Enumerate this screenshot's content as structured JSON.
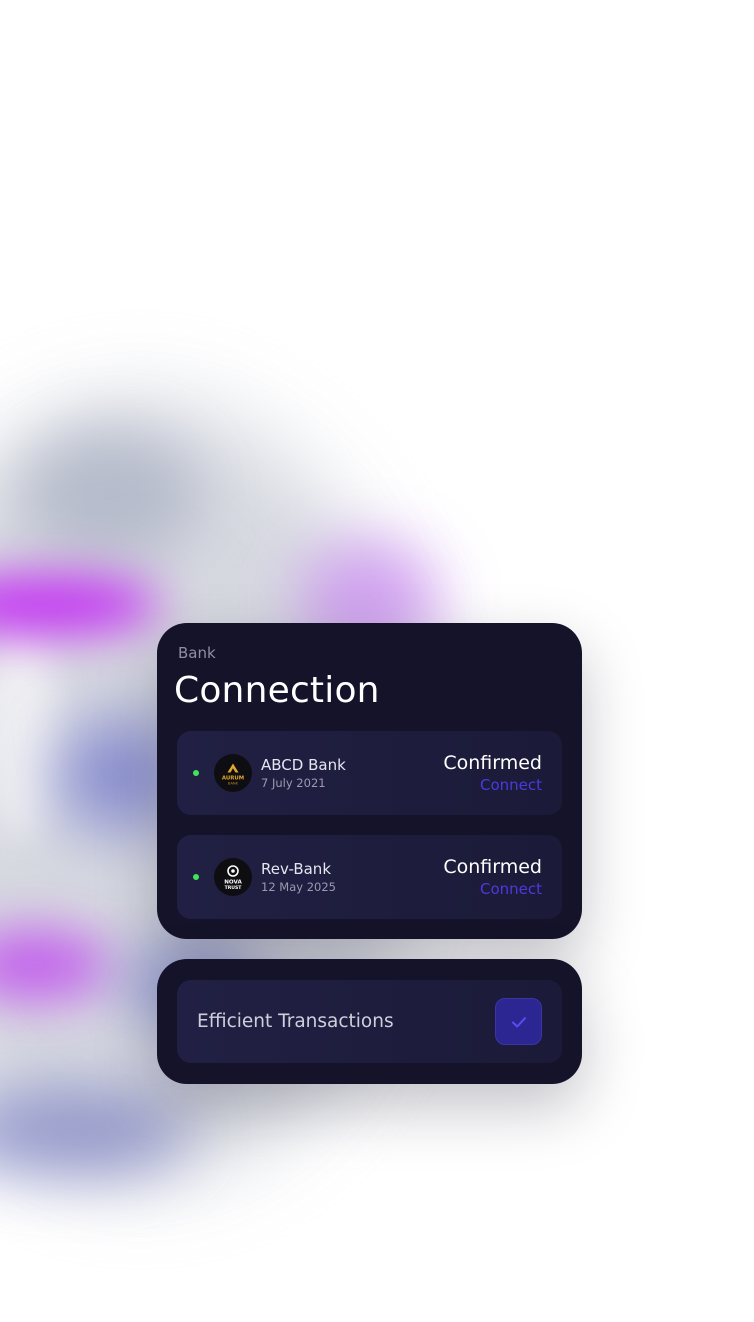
{
  "connection_card": {
    "subtitle": "Bank",
    "title": "Connection",
    "banks": [
      {
        "name": "ABCD Bank",
        "date": "7 July 2021",
        "status": "Confirmed",
        "action": "Connect",
        "logo": {
          "icon": "aurum-bank-logo",
          "text_top": "AURUM",
          "text_bottom": "BANK",
          "color": "#e0a82e"
        },
        "dot_color": "#3ee65a"
      },
      {
        "name": "Rev-Bank",
        "date": "12 May 2025",
        "status": "Confirmed",
        "action": "Connect",
        "logo": {
          "icon": "nova-trust-logo",
          "text_top": "NOVA",
          "text_bottom": "TRUST",
          "color": "#ffffff"
        },
        "dot_color": "#3ee65a"
      }
    ]
  },
  "efficient_card": {
    "label": "Efficient Transactions",
    "checked": true,
    "check_icon": "checkmark-icon"
  },
  "colors": {
    "card_bg": "#14132a",
    "row_bg": "#212044",
    "accent": "#4a3ae0",
    "status_green": "#3ee65a",
    "checkbox_bg": "#2b2691"
  }
}
